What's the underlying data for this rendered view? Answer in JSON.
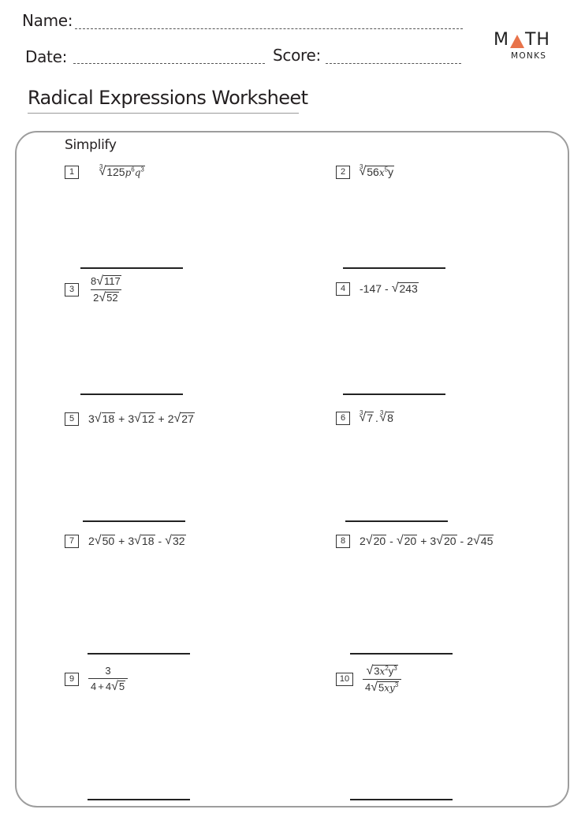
{
  "header": {
    "name_label": "Name:",
    "date_label": "Date:",
    "score_label": "Score:"
  },
  "logo": {
    "math_left": "M",
    "math_right": "TH",
    "monks": "MONKS",
    "accent_color": "#e8734a"
  },
  "title": "Radical Expressions Worksheet",
  "instruction": "Simplify",
  "questions": [
    {
      "num": "1",
      "text": "∛(125p^6 q^3)"
    },
    {
      "num": "2",
      "text": "∛(56x^5 y)"
    },
    {
      "num": "3",
      "text": "8√117 / 2√52"
    },
    {
      "num": "4",
      "text": "-147 - √243"
    },
    {
      "num": "5",
      "text": "3√18 + 3√12 + 2√27"
    },
    {
      "num": "6",
      "text": "∛7 . ∛8"
    },
    {
      "num": "7",
      "text": "2√50 + 3√18 - √32"
    },
    {
      "num": "8",
      "text": "2√20 - √20 + 3√20 - 2√45"
    },
    {
      "num": "9",
      "text": "3 / (4 + 4√5)"
    },
    {
      "num": "10",
      "text": "√(3x^2 y^3) / 4√(5xy^3)"
    }
  ],
  "parts": {
    "q1": {
      "index": "3",
      "coef": "125",
      "v1": "p",
      "e1": "6",
      "v2": "q",
      "e2": "3"
    },
    "q2": {
      "index": "3",
      "coef": "56",
      "v1": "x",
      "e1": "5",
      "v2": "y"
    },
    "q3": {
      "num_coef": "8",
      "num_rad": "117",
      "den_coef": "2",
      "den_rad": "52"
    },
    "q4": {
      "lead": "-147",
      "op": "-",
      "rad": "243"
    },
    "q5": {
      "c1": "3",
      "r1": "18",
      "op1": "+",
      "c2": "3",
      "r2": "12",
      "op2": "+",
      "c3": "2",
      "r3": "27"
    },
    "q6": {
      "index": "3",
      "r1": "7",
      "dot": ".",
      "r2": "8"
    },
    "q7": {
      "c1": "2",
      "r1": "50",
      "op1": "+",
      "c2": "3",
      "r2": "18",
      "op2": "-",
      "r3": "32"
    },
    "q8": {
      "c1": "2",
      "r1": "20",
      "op1": "-",
      "r2": "20",
      "op2": "+",
      "c3": "3",
      "r3": "20",
      "op3": "-",
      "c4": "2",
      "r4": "45"
    },
    "q9": {
      "num": "3",
      "den_a": "4",
      "op": "+",
      "den_c": "4",
      "den_rad": "5"
    },
    "q10": {
      "num_coef": "3",
      "nv1": "x",
      "ne1": "2",
      "nv2": "y",
      "ne2": "3",
      "den_coef": "4",
      "den_rad_coef": "5",
      "dv": "xy",
      "de": "3"
    }
  }
}
